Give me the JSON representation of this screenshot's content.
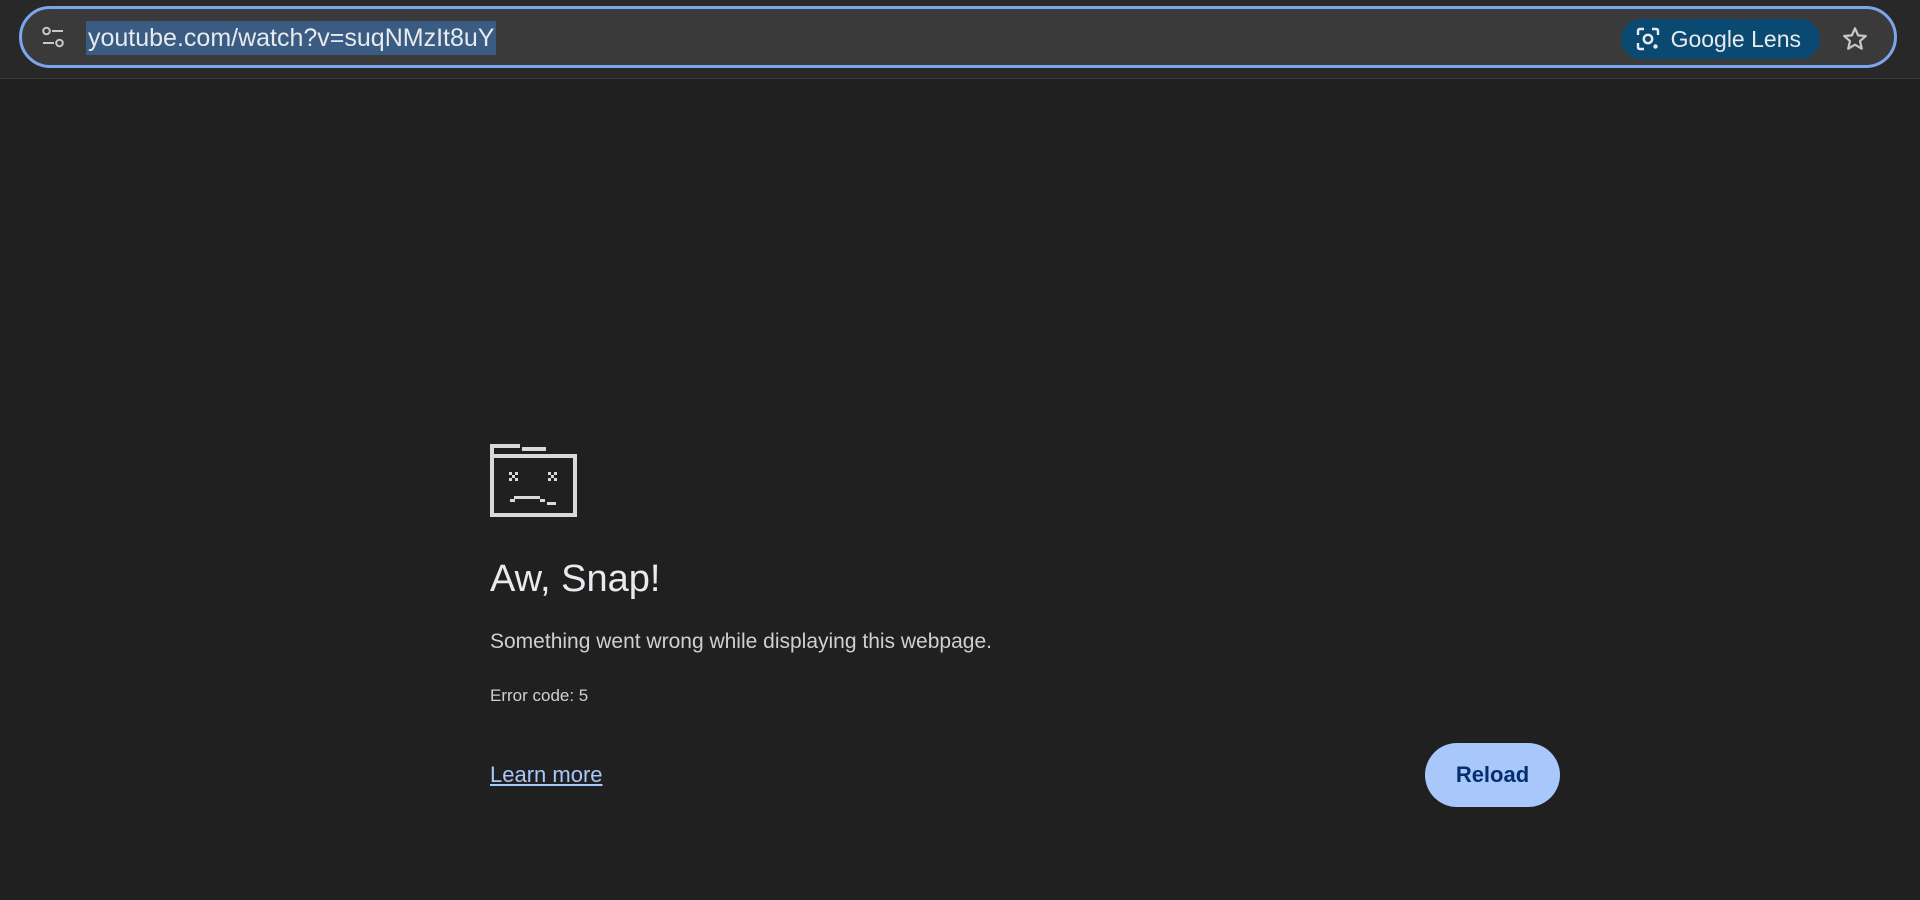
{
  "omnibox": {
    "url": "youtube.com/watch?v=suqNMzIt8uY",
    "site_info_icon": "tune-icon",
    "lens_label": "Google Lens",
    "lens_icon": "google-lens-icon",
    "bookmark_icon": "star-outline-icon"
  },
  "error_page": {
    "illustration": "sad-tab-icon",
    "title": "Aw, Snap!",
    "message": "Something went wrong while displaying this webpage.",
    "error_code": "Error code: 5",
    "learn_more": "Learn more",
    "reload_label": "Reload"
  },
  "colors": {
    "background": "#202020",
    "omnibox_border": "#7ca6ec",
    "lens_chip": "#0a4a72",
    "accent": "#a8c7fa",
    "reload_text": "#062e6f"
  }
}
